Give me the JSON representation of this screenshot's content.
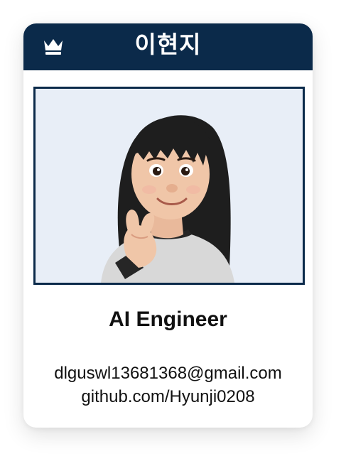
{
  "card": {
    "name": "이현지",
    "role": "AI Engineer",
    "email": "dlguswl13681368@gmail.com",
    "github": "github.com/Hyunji0208",
    "header_icon": "crown-icon",
    "avatar_icon": "memoji-avatar-finger-heart"
  },
  "colors": {
    "header_bg": "#0b2a4a",
    "photo_bg": "#e8eef7",
    "text": "#111111"
  }
}
